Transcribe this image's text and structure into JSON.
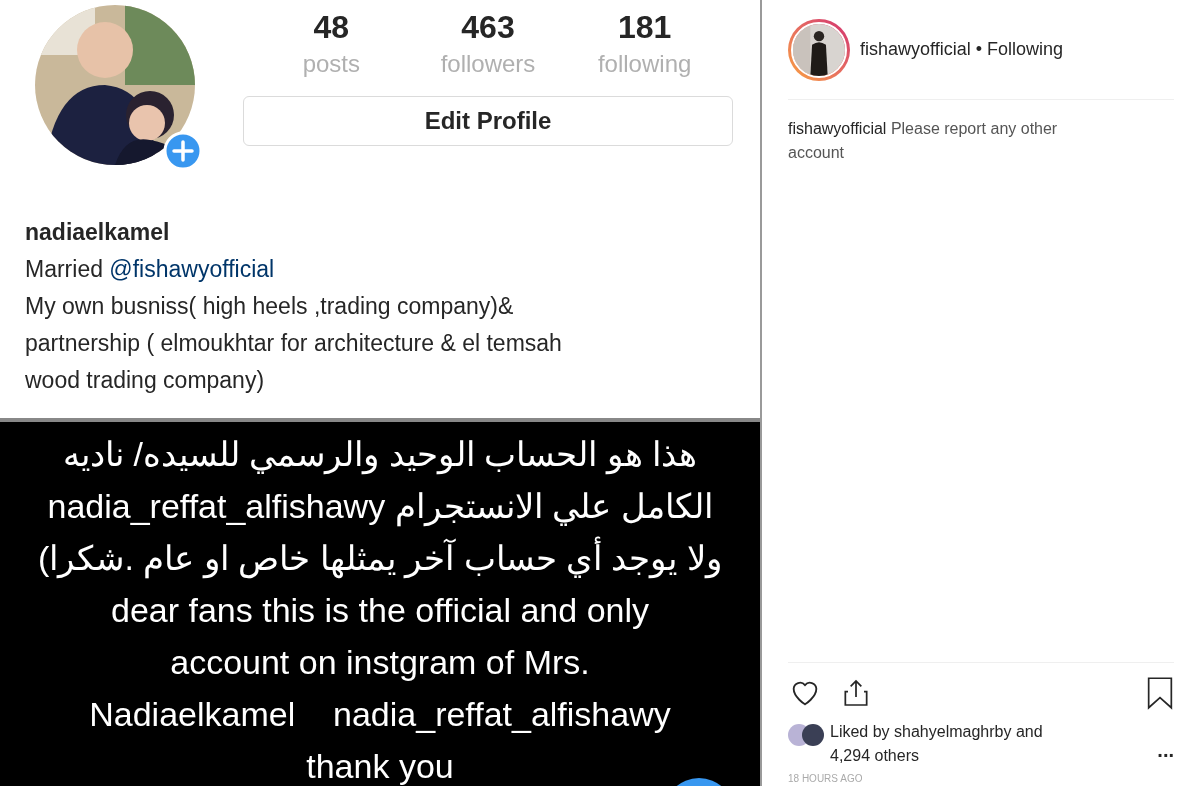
{
  "profile": {
    "stats": [
      {
        "value": "48",
        "label": "posts"
      },
      {
        "value": "463",
        "label": "followers"
      },
      {
        "value": "181",
        "label": "following"
      }
    ],
    "edit_button": "Edit Profile",
    "username": "nadiaelkamel",
    "bio": [
      {
        "text": "Married ",
        "link": "@fishawyofficial"
      },
      {
        "text": "My own busniss( high heels ,trading company)&"
      },
      {
        "text": "partnership ( elmoukhtar for architecture & el temsah"
      },
      {
        "text": "wood trading company)"
      }
    ]
  },
  "post_image": {
    "lines": [
      "هذا هو الحساب الوحيد والرسمي للسيده/ ناديه",
      "الكامل علي الانستجرام nadia_reffat_alfishawy",
      "ولا يوجد أي حساب آخر يمثلها خاص او عام .شكرا)",
      "dear fans this is the official and only",
      "account on instgram of Mrs.",
      "Nadiaelkamel    nadia_reffat_alfishawy",
      "thank you"
    ]
  },
  "post_panel": {
    "author": "fishawyofficial",
    "follow_status": "• Following",
    "caption": {
      "user": "fishawyofficial",
      "text": "Please report any other account"
    },
    "liked_by": "Liked by shahyelmaghrby and 4,294 others",
    "more": "...",
    "time": "18 HOURS AGO"
  }
}
